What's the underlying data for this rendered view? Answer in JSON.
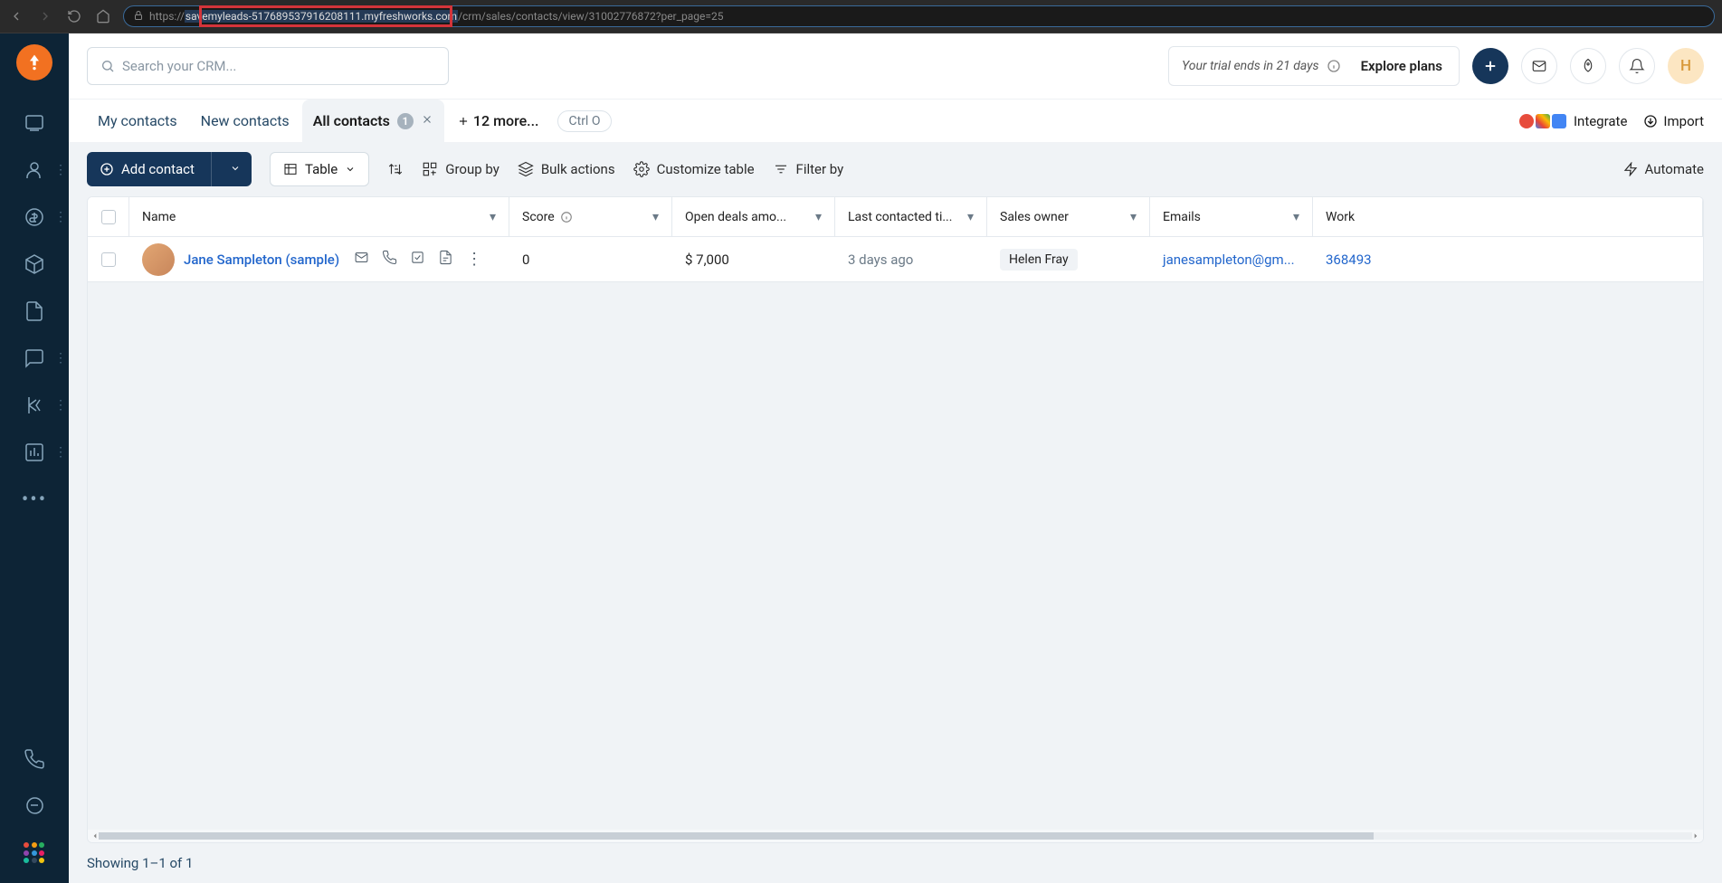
{
  "browser": {
    "url_prefix": "https://",
    "url_highlighted": "savemyleads-517689537916208111.myfreshworks.com",
    "url_suffix": "/crm/sales/contacts/view/31002776872?per_page=25"
  },
  "search": {
    "placeholder": "Search your CRM..."
  },
  "trial": {
    "text": "Your trial ends in 21 days",
    "explore": "Explore plans"
  },
  "avatar_initial": "H",
  "tabs": {
    "my_contacts": "My contacts",
    "new_contacts": "New contacts",
    "all_contacts": "All contacts",
    "all_contacts_count": "1",
    "more": "12 more...",
    "shortcut": "Ctrl O",
    "integrate": "Integrate",
    "import": "Import"
  },
  "toolbar": {
    "add_contact": "Add contact",
    "table": "Table",
    "group_by": "Group by",
    "bulk_actions": "Bulk actions",
    "customize": "Customize table",
    "filter_by": "Filter by",
    "automate": "Automate"
  },
  "columns": {
    "name": "Name",
    "score": "Score",
    "open_deals": "Open deals amo...",
    "last_contacted": "Last contacted ti...",
    "sales_owner": "Sales owner",
    "emails": "Emails",
    "work": "Work"
  },
  "row": {
    "name": "Jane Sampleton (sample)",
    "score": "0",
    "open_deals": "$ 7,000",
    "last_contacted": "3 days ago",
    "sales_owner": "Helen Fray",
    "email": "janesampleton@gm...",
    "work": "368493"
  },
  "footer": "Showing 1–1 of 1"
}
